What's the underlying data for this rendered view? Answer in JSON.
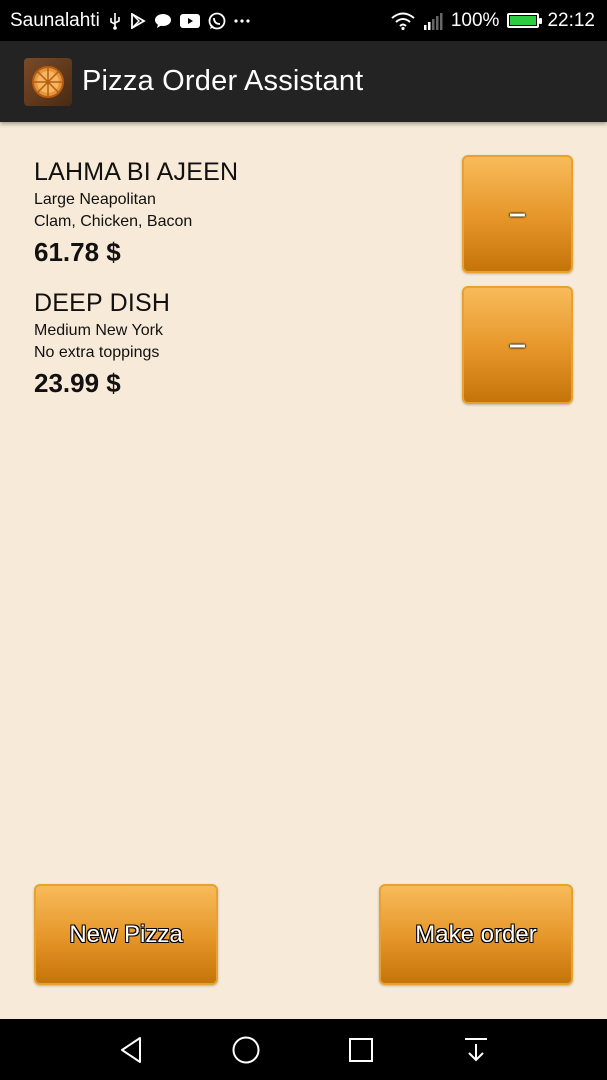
{
  "status_bar": {
    "carrier": "Saunalahti",
    "battery": "100%",
    "battery_level": 1.0,
    "time": "22:12",
    "left_icons": [
      "usb-icon",
      "play-store-icon",
      "chat-icon",
      "youtube-icon",
      "whatsapp-icon",
      "more-dots-icon"
    ],
    "right_icons": [
      "wifi-icon",
      "signal-icon",
      "battery-icon"
    ]
  },
  "app_bar": {
    "title": "Pizza Order Assistant",
    "icon": "pizza-icon"
  },
  "order_items": [
    {
      "name": "LAHMA BI AJEEN",
      "size_style": "Large Neapolitan",
      "toppings": "Clam, Chicken, Bacon",
      "price": "61.78 $",
      "remove_label": "–"
    },
    {
      "name": "DEEP DISH",
      "size_style": "Medium New York",
      "toppings": "No extra toppings",
      "price": "23.99 $",
      "remove_label": "–"
    }
  ],
  "actions": {
    "new_pizza": "New Pizza",
    "make_order": "Make order"
  },
  "nav_bar": {
    "icons": [
      "back-icon",
      "home-icon",
      "recents-icon",
      "notification-pull-icon"
    ]
  },
  "colors": {
    "background": "#f8ead8",
    "button_top": "#f8bb5a",
    "button_bottom": "#c47408",
    "app_bar": "#232323"
  }
}
